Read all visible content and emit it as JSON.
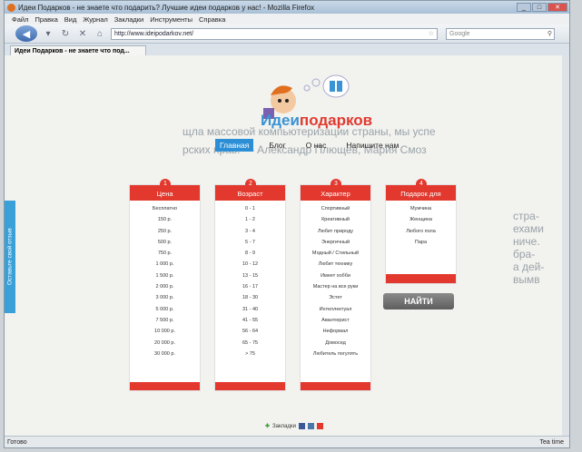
{
  "window": {
    "title": "Идеи Подарков - не знаете что подарить? Лучшие идеи подарков у нас! - Mozilla Firefox"
  },
  "menu": [
    "Файл",
    "Правка",
    "Вид",
    "Журнал",
    "Закладки",
    "Инструменты",
    "Справка"
  ],
  "toolbar": {
    "url": "http://www.ideipodarkov.net/",
    "search_placeholder": "Google"
  },
  "tab": {
    "label": "Идеи Подарков - не знаете что под..."
  },
  "page": {
    "logo_part1": "Идеи",
    "logo_part2": "подарков",
    "nav": [
      "Главная",
      "Блог",
      "О нас",
      "Напишите нам"
    ],
    "feedback_label": "Оставьте свой отзыв",
    "find_button": "НАЙТИ",
    "bookmarks_label": "Закладки",
    "columns": [
      {
        "num": "1",
        "title": "Цена",
        "items": [
          "Бесплатно",
          "150 р.",
          "250 р.",
          "500 р.",
          "750 р.",
          "1 000 р.",
          "1 500 р.",
          "2 000 р.",
          "3 000 р.",
          "5 000 р.",
          "7 500 р.",
          "10 000 р.",
          "20 000 р.",
          "30 000 р."
        ]
      },
      {
        "num": "2",
        "title": "Возраст",
        "items": [
          "0 - 1",
          "1 - 2",
          "3 - 4",
          "5 - 7",
          "8 - 9",
          "10 - 12",
          "13 - 15",
          "16 - 17",
          "18 - 30",
          "31 - 40",
          "41 - 55",
          "56 - 64",
          "65 - 75",
          "> 75"
        ]
      },
      {
        "num": "3",
        "title": "Характер",
        "items": [
          "Спортивный",
          "Креативный",
          "Любит природу",
          "Энергичный",
          "Модный / Стильный",
          "Любит технику",
          "Имеет хобби",
          "Мастер на все руки",
          "Эстет",
          "Интеллектуал",
          "Авантюрист",
          "Неформал",
          "Домосед",
          "Любитель погулять"
        ]
      },
      {
        "num": "4",
        "title": "Подарок для",
        "items": [
          "Мужчина",
          "Женщина",
          "Любого пола",
          "Пара"
        ]
      }
    ]
  },
  "background_text": {
    "line1": "щла массовой компьютеризации страны, мы успе",
    "line2": "рских прав. — Александр Плющев, Мария Смоз",
    "right_lines": [
      "стра-",
      "ехами",
      "ниче.",
      "бра-",
      "а дей-",
      "вымв"
    ]
  },
  "status": {
    "text": "Готово",
    "right": "Tea time"
  },
  "colors": {
    "brand_blue": "#3a93d4",
    "brand_red": "#e2382e",
    "nav_active": "#2c8fd6"
  }
}
